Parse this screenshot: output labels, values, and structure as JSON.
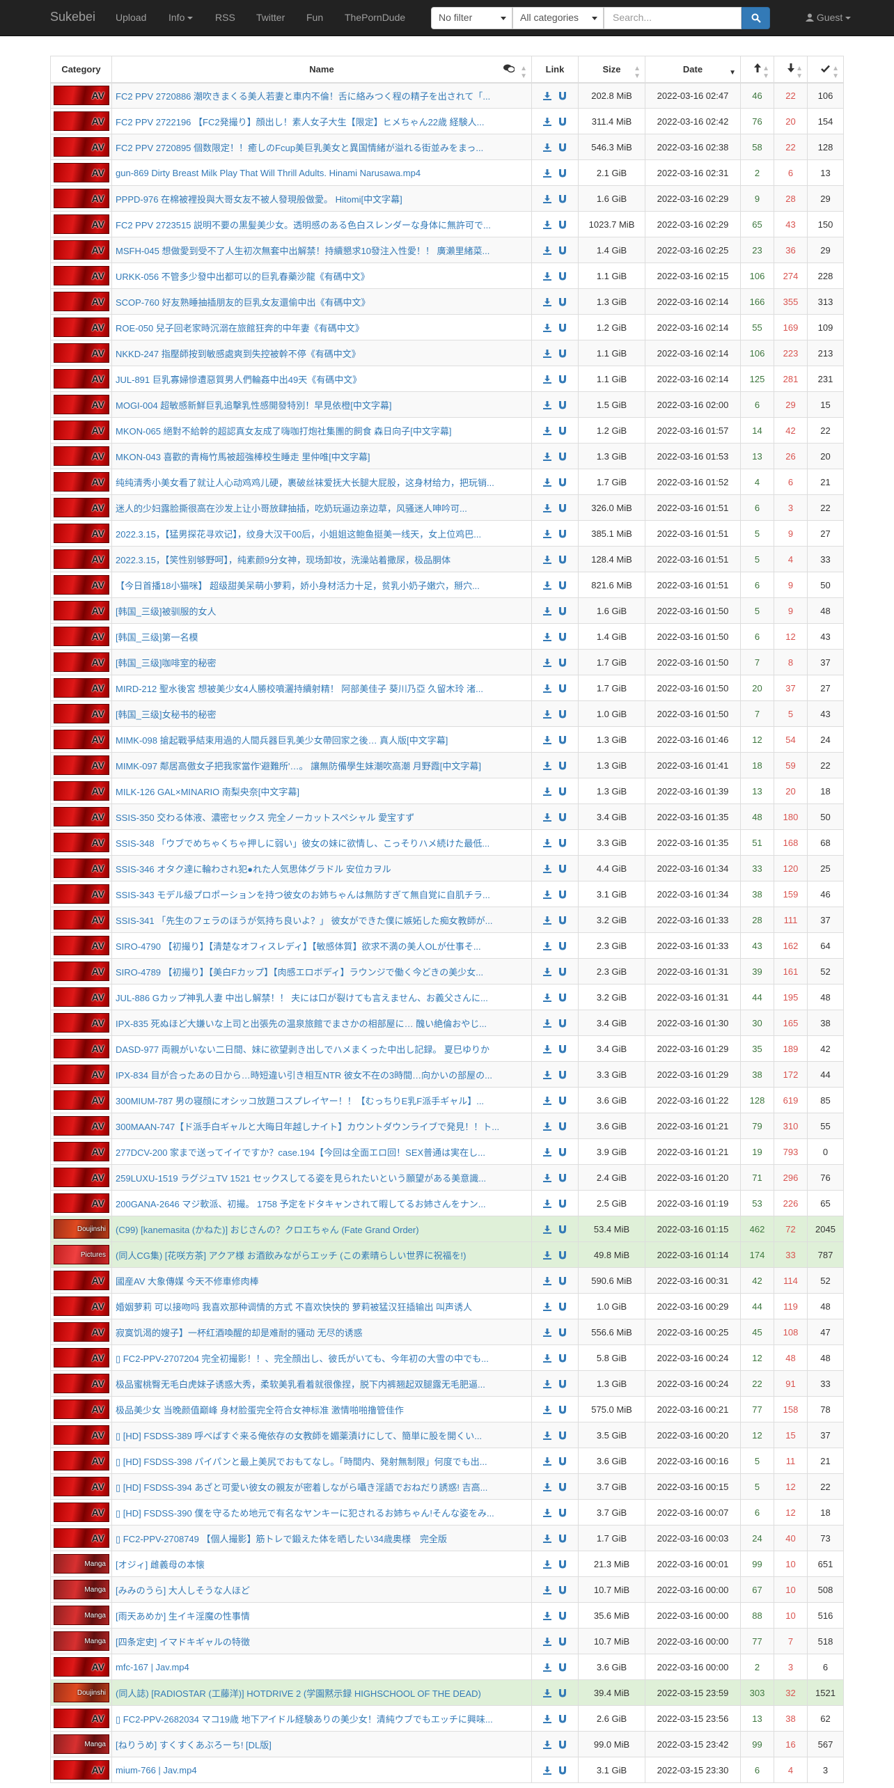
{
  "nav": {
    "brand": "Sukebei",
    "upload": "Upload",
    "info": "Info",
    "rss": "RSS",
    "twitter": "Twitter",
    "fun": "Fun",
    "theporndude": "ThePornDude",
    "filter": "No filter",
    "category": "All categories",
    "search_placeholder": "Search...",
    "guest": "Guest"
  },
  "columns": {
    "category": "Category",
    "name": "Name",
    "link": "Link",
    "size": "Size",
    "date": "Date"
  },
  "rows": [
    {
      "cat": "AV",
      "name": "FC2 PPV 2720886 潮吹きまくる美人若妻と車内不倫！舌に絡みつく程の精子を出されて「...",
      "size": "202.8 MiB",
      "date": "2022-03-16 02:47",
      "seed": "46",
      "leech": "22",
      "dl": "106"
    },
    {
      "cat": "AV",
      "name": "FC2 PPV 2722196 【FC2発撮り】顔出し！素人女子大生【限定】ヒメちゃん22歳 経験人...",
      "size": "311.4 MiB",
      "date": "2022-03-16 02:42",
      "seed": "76",
      "leech": "20",
      "dl": "154"
    },
    {
      "cat": "AV",
      "name": "FC2 PPV 2720895 個数限定！！癒しのFcup美巨乳美女と異国情緒が溢れる街並みをまっ...",
      "size": "546.3 MiB",
      "date": "2022-03-16 02:38",
      "seed": "58",
      "leech": "22",
      "dl": "128"
    },
    {
      "cat": "AV",
      "name": "gun-869 Dirty Breast Milk Play That Will Thrill Adults. Hinami Narusawa.mp4",
      "size": "2.1 GiB",
      "date": "2022-03-16 02:31",
      "seed": "2",
      "leech": "6",
      "dl": "13"
    },
    {
      "cat": "AV",
      "name": "PPPD-976 在棉被裡投與大哥女友不被人發現般做愛。 Hitomi[中文字幕]",
      "size": "1.6 GiB",
      "date": "2022-03-16 02:29",
      "seed": "9",
      "leech": "28",
      "dl": "29"
    },
    {
      "cat": "AV",
      "name": "FC2 PPV 2723515 説明不要の黒髪美少女。透明感のある色白スレンダーな身体に無許可で...",
      "size": "1023.7 MiB",
      "date": "2022-03-16 02:29",
      "seed": "65",
      "leech": "43",
      "dl": "150"
    },
    {
      "cat": "AV",
      "name": "MSFH-045 想做愛到受不了人生初次無套中出解禁！持續懇求10發注入性愛！！ 廣瀨里緒菜...",
      "size": "1.4 GiB",
      "date": "2022-03-16 02:25",
      "seed": "23",
      "leech": "36",
      "dl": "29"
    },
    {
      "cat": "AV",
      "name": "URKK-056 不管多少發中出都可以的巨乳春藥沙龍《有碼中文》",
      "size": "1.1 GiB",
      "date": "2022-03-16 02:15",
      "seed": "106",
      "leech": "274",
      "dl": "228"
    },
    {
      "cat": "AV",
      "name": "SCOP-760 好友熟睡抽插朋友的巨乳女友還偷中出《有碼中文》",
      "size": "1.3 GiB",
      "date": "2022-03-16 02:14",
      "seed": "166",
      "leech": "355",
      "dl": "313"
    },
    {
      "cat": "AV",
      "name": "ROE-050 兒子回老家時沉溺在旅館狂奔的中年妻《有碼中文》",
      "size": "1.2 GiB",
      "date": "2022-03-16 02:14",
      "seed": "55",
      "leech": "169",
      "dl": "109"
    },
    {
      "cat": "AV",
      "name": "NKKD-247 指壓師按到敏感處爽到失控被幹不停《有碼中文》",
      "size": "1.1 GiB",
      "date": "2022-03-16 02:14",
      "seed": "106",
      "leech": "223",
      "dl": "213"
    },
    {
      "cat": "AV",
      "name": "JUL-891 巨乳寡婦慘遭惡質男人們輪姦中出49天《有碼中文》",
      "size": "1.1 GiB",
      "date": "2022-03-16 02:14",
      "seed": "125",
      "leech": "281",
      "dl": "231"
    },
    {
      "cat": "AV",
      "name": "MOGI-004 超敏感新鮮巨乳追擊乳性感開發特別！早見依橙[中文字幕]",
      "size": "1.5 GiB",
      "date": "2022-03-16 02:00",
      "seed": "6",
      "leech": "29",
      "dl": "15"
    },
    {
      "cat": "AV",
      "name": "MKON-065 絕對不給幹的超認真女友成了嗨咖打炮社集團的飼食 森日向子[中文字幕]",
      "size": "1.2 GiB",
      "date": "2022-03-16 01:57",
      "seed": "14",
      "leech": "42",
      "dl": "22"
    },
    {
      "cat": "AV",
      "name": "MKON-043 喜歡的青梅竹馬被超強棒校生睡走 里仲唯[中文字幕]",
      "size": "1.3 GiB",
      "date": "2022-03-16 01:53",
      "seed": "13",
      "leech": "26",
      "dl": "20"
    },
    {
      "cat": "AV",
      "name": "纯纯清秀小美女看了就让人心动鸡鸡儿硬，裹破丝袜爱抚大长腿大屁股，这身材给力，把玩销...",
      "size": "1.7 GiB",
      "date": "2022-03-16 01:52",
      "seed": "4",
      "leech": "6",
      "dl": "21"
    },
    {
      "cat": "AV",
      "name": "迷人的少妇露脸撕很高在沙发上让小哥放肆抽插，吃奶玩逼边亲边草，风骚迷人呻吟可...",
      "size": "326.0 MiB",
      "date": "2022-03-16 01:51",
      "seed": "6",
      "leech": "3",
      "dl": "22"
    },
    {
      "cat": "AV",
      "name": "2022.3.15，【猛男探花寻欢记】，纹身大汉干00后，小姐姐这鲍鱼挺美一线天，女上位鸡巴...",
      "size": "385.1 MiB",
      "date": "2022-03-16 01:51",
      "seed": "5",
      "leech": "9",
      "dl": "27"
    },
    {
      "cat": "AV",
      "name": "2022.3.15，【笑性别够野呵】，纯素颜9分女神，现场卸妆，洗澡站着撒尿，极品胴体",
      "size": "128.4 MiB",
      "date": "2022-03-16 01:51",
      "seed": "5",
      "leech": "4",
      "dl": "33"
    },
    {
      "cat": "AV",
      "name": "【今日首播18小猫咪】 超级甜美呆萌小萝莉，娇小身材活力十足，贫乳小奶子嫩穴，掰穴...",
      "size": "821.6 MiB",
      "date": "2022-03-16 01:51",
      "seed": "6",
      "leech": "9",
      "dl": "50"
    },
    {
      "cat": "AV",
      "name": "[韩国_三级]被驯服的女人",
      "size": "1.6 GiB",
      "date": "2022-03-16 01:50",
      "seed": "5",
      "leech": "9",
      "dl": "48"
    },
    {
      "cat": "AV",
      "name": "[韩国_三级]第一名模",
      "size": "1.4 GiB",
      "date": "2022-03-16 01:50",
      "seed": "6",
      "leech": "12",
      "dl": "43"
    },
    {
      "cat": "AV",
      "name": "[韩国_三级]咖啡室的秘密",
      "size": "1.7 GiB",
      "date": "2022-03-16 01:50",
      "seed": "7",
      "leech": "8",
      "dl": "37"
    },
    {
      "cat": "AV",
      "name": "MIRD-212 聖水後宮 想被美少女4人勝校噴灑持續射精！ 阿部美佳子 葵川乃亞 久留木玲 渚...",
      "size": "1.7 GiB",
      "date": "2022-03-16 01:50",
      "seed": "20",
      "leech": "37",
      "dl": "27"
    },
    {
      "cat": "AV",
      "name": "[韩国_三级]女秘书的秘密",
      "size": "1.0 GiB",
      "date": "2022-03-16 01:50",
      "seed": "7",
      "leech": "5",
      "dl": "43"
    },
    {
      "cat": "AV",
      "name": "MIMK-098 搶起戰爭結束用過的人間兵器巨乳美少女帶回家之後… 真人版[中文字幕]",
      "size": "1.3 GiB",
      "date": "2022-03-16 01:46",
      "seed": "12",
      "leech": "54",
      "dl": "24"
    },
    {
      "cat": "AV",
      "name": "MIMK-097 鄰居高傲女子把我家當作'避難所'…。 讓無防備學生妹潮吹高潮 月野霞[中文字幕]",
      "size": "1.3 GiB",
      "date": "2022-03-16 01:41",
      "seed": "18",
      "leech": "59",
      "dl": "22"
    },
    {
      "cat": "AV",
      "name": "MILK-126 GAL×MINARIO 南梨央奈[中文字幕]",
      "size": "1.3 GiB",
      "date": "2022-03-16 01:39",
      "seed": "13",
      "leech": "20",
      "dl": "18"
    },
    {
      "cat": "AV",
      "name": "SSIS-350 交わる体液、濃密セックス 完全ノーカットスペシャル 愛宝すず",
      "size": "3.4 GiB",
      "date": "2022-03-16 01:35",
      "seed": "48",
      "leech": "180",
      "dl": "50"
    },
    {
      "cat": "AV",
      "name": "SSIS-348 「ウブでめちゃくちゃ押しに弱い」彼女の妹に欲情し、こっそりハメ続けた最低...",
      "size": "3.3 GiB",
      "date": "2022-03-16 01:35",
      "seed": "51",
      "leech": "168",
      "dl": "68"
    },
    {
      "cat": "AV",
      "name": "SSIS-346 オタク達に輪わされ犯●れた人気思体グラドル 安位カヲル",
      "size": "4.4 GiB",
      "date": "2022-03-16 01:34",
      "seed": "33",
      "leech": "120",
      "dl": "25"
    },
    {
      "cat": "AV",
      "name": "SSIS-343 モデル級プロポーションを持つ彼女のお姉ちゃんは無防すぎて無自覚に自肌チラ...",
      "size": "3.1 GiB",
      "date": "2022-03-16 01:34",
      "seed": "38",
      "leech": "159",
      "dl": "46"
    },
    {
      "cat": "AV",
      "name": "SSIS-341 「先生のフェラのほうが気持ち良いよ？」 彼女ができた僕に嫉妬した痴女教師が...",
      "size": "3.2 GiB",
      "date": "2022-03-16 01:33",
      "seed": "28",
      "leech": "111",
      "dl": "37"
    },
    {
      "cat": "AV",
      "name": "SIRO-4790 【初撮り】【清楚なオフィスレディ】【敏感体質】欲求不満の美人OLが仕事そ...",
      "size": "2.3 GiB",
      "date": "2022-03-16 01:33",
      "seed": "43",
      "leech": "162",
      "dl": "64"
    },
    {
      "cat": "AV",
      "name": "SIRO-4789 【初撮り】【美白Fカップ】【肉感エロボディ】ラウンジで働く今どきの美少女...",
      "size": "2.3 GiB",
      "date": "2022-03-16 01:31",
      "seed": "39",
      "leech": "161",
      "dl": "52"
    },
    {
      "cat": "AV",
      "name": "JUL-886 Gカップ神乳人妻 中出し解禁！！ 夫には口が裂けても言えません、お義父さんに...",
      "size": "3.2 GiB",
      "date": "2022-03-16 01:31",
      "seed": "44",
      "leech": "195",
      "dl": "48"
    },
    {
      "cat": "AV",
      "name": "IPX-835 死ぬほど大嫌いな上司と出張先の温泉旅館でまさかの相部屋に… 醜い絶倫おやじ...",
      "size": "3.4 GiB",
      "date": "2022-03-16 01:30",
      "seed": "30",
      "leech": "165",
      "dl": "38"
    },
    {
      "cat": "AV",
      "name": "DASD-977 両親がいない二日間、妹に欲望剥き出しでハメまくった中出し記録。 夏巳ゆりか",
      "size": "3.4 GiB",
      "date": "2022-03-16 01:29",
      "seed": "35",
      "leech": "189",
      "dl": "42"
    },
    {
      "cat": "AV",
      "name": "IPX-834 目が合ったあの日から…時短違い引き相互NTR 彼女不在の3時間…向かいの部屋の...",
      "size": "3.3 GiB",
      "date": "2022-03-16 01:29",
      "seed": "38",
      "leech": "172",
      "dl": "44"
    },
    {
      "cat": "AV",
      "name": "300MIUM-787 男の寝顔にオシッコ放題コスプレイヤー！！【むっちりE乳F派手ギャル】...",
      "size": "3.6 GiB",
      "date": "2022-03-16 01:22",
      "seed": "128",
      "leech": "619",
      "dl": "85"
    },
    {
      "cat": "AV",
      "name": "300MAAN-747【ド派手白ギャルと大晦日年越しナイト】カウントダウンライブで発見！！ト...",
      "size": "3.6 GiB",
      "date": "2022-03-16 01:21",
      "seed": "79",
      "leech": "310",
      "dl": "55"
    },
    {
      "cat": "AV",
      "name": "277DCV-200 家まで送ってイイですか？case.194【今回は全面エロ回！SEX普通は実在し...",
      "size": "3.9 GiB",
      "date": "2022-03-16 01:21",
      "seed": "19",
      "leech": "793",
      "dl": "0"
    },
    {
      "cat": "AV",
      "name": "259LUXU-1519 ラグジュTV 1521 セックスしてる姿を見られたいという願望がある美意識...",
      "size": "2.4 GiB",
      "date": "2022-03-16 01:20",
      "seed": "71",
      "leech": "296",
      "dl": "76"
    },
    {
      "cat": "AV",
      "name": "200GANA-2646 マジ軟派、初撮。 1758 予定をドタキャンされて暇してるお姉さんをナン...",
      "size": "2.5 GiB",
      "date": "2022-03-16 01:19",
      "seed": "53",
      "leech": "226",
      "dl": "65"
    },
    {
      "cat": "Doujinshi",
      "name": "(C99) [kanemasita (かねた)] おじさんの？クロエちゃん (Fate Grand Order)",
      "size": "53.4 MiB",
      "date": "2022-03-16 01:15",
      "seed": "462",
      "leech": "72",
      "dl": "2045",
      "trusted": true
    },
    {
      "cat": "Pictures",
      "name": "(同人CG集) [花咲方茶] アクア様 お酒飲みながらエッチ (この素晴らしい世界に祝福を!)",
      "size": "49.8 MiB",
      "date": "2022-03-16 01:14",
      "seed": "174",
      "leech": "33",
      "dl": "787",
      "trusted": true
    },
    {
      "cat": "AV",
      "name": "國産AV 大象傳媒 今天不修車修肉棒",
      "size": "590.6 MiB",
      "date": "2022-03-16 00:31",
      "seed": "42",
      "leech": "114",
      "dl": "52"
    },
    {
      "cat": "AV",
      "name": "婚姻萝莉 可以接吻吗 我喜欢那种调情的方式 不喜欢快快的 萝莉被猛汉狂插输出 叫声诱人",
      "size": "1.0 GiB",
      "date": "2022-03-16 00:29",
      "seed": "44",
      "leech": "119",
      "dl": "48"
    },
    {
      "cat": "AV",
      "name": "寂寞饥渴的嫂子】一杯红酒喚醒的却是难耐的骚动 无尽的诱惑",
      "size": "556.6 MiB",
      "date": "2022-03-16 00:25",
      "seed": "45",
      "leech": "108",
      "dl": "47"
    },
    {
      "cat": "AV",
      "name": "▯ FC2-PPV-2707204 完全初撮影！！、完全顔出し、彼氏がいても、今年初の大雪の中でも...",
      "size": "5.8 GiB",
      "date": "2022-03-16 00:24",
      "seed": "12",
      "leech": "48",
      "dl": "48"
    },
    {
      "cat": "AV",
      "name": "极品蜜桃臀无毛白虎妹子诱惑大秀，柔软美乳看着就很像捏，脱下内裤翘起双腿露无毛肥逼...",
      "size": "1.3 GiB",
      "date": "2022-03-16 00:24",
      "seed": "22",
      "leech": "91",
      "dl": "33"
    },
    {
      "cat": "AV",
      "name": "极品美少女 当晚颜值巅峰 身材脸蛋完全符合女神标准 激情啪啪撸管佳作",
      "size": "575.0 MiB",
      "date": "2022-03-16 00:21",
      "seed": "77",
      "leech": "158",
      "dl": "78"
    },
    {
      "cat": "AV",
      "name": "▯ [HD] FSDSS-389 呼べばすぐ来る俺依存の女教師を媚薬漬けにして、簡単に股を開くい...",
      "size": "3.5 GiB",
      "date": "2022-03-16 00:20",
      "seed": "12",
      "leech": "15",
      "dl": "37"
    },
    {
      "cat": "AV",
      "name": "▯ [HD] FSDSS-398 パイパンと最上美尻でおもてなし。「時間内、発射無制限」何度でも出...",
      "size": "3.6 GiB",
      "date": "2022-03-16 00:16",
      "seed": "5",
      "leech": "11",
      "dl": "21"
    },
    {
      "cat": "AV",
      "name": "▯ [HD] FSDSS-394 あざと可愛い彼女の親友が密着しながら囁き淫語でおねだり誘惑! 吉高...",
      "size": "3.7 GiB",
      "date": "2022-03-16 00:15",
      "seed": "5",
      "leech": "12",
      "dl": "22"
    },
    {
      "cat": "AV",
      "name": "▯ [HD] FSDSS-390 僕を守るため地元で有名なヤンキーに犯されるお姉ちゃん!そんな姿をみ...",
      "size": "3.7 GiB",
      "date": "2022-03-16 00:07",
      "seed": "6",
      "leech": "12",
      "dl": "18"
    },
    {
      "cat": "AV",
      "name": "▯ FC2-PPV-2708749 【個人撮影】筋トレで鍛えた体を晒したい34歳奥様　完全版",
      "size": "1.7 GiB",
      "date": "2022-03-16 00:03",
      "seed": "24",
      "leech": "40",
      "dl": "73"
    },
    {
      "cat": "Manga",
      "name": "[オジィ] 雌義母の本懐",
      "size": "21.3 MiB",
      "date": "2022-03-16 00:01",
      "seed": "99",
      "leech": "10",
      "dl": "651"
    },
    {
      "cat": "Manga",
      "name": "[みみのうら] 大人しそうな人ほど",
      "size": "10.7 MiB",
      "date": "2022-03-16 00:00",
      "seed": "67",
      "leech": "10",
      "dl": "508"
    },
    {
      "cat": "Manga",
      "name": "[雨天あめか] 生イキ淫魔の性事情",
      "size": "35.6 MiB",
      "date": "2022-03-16 00:00",
      "seed": "88",
      "leech": "10",
      "dl": "516"
    },
    {
      "cat": "Manga",
      "name": "[四条定史] イマドキギャルの特徴",
      "size": "10.7 MiB",
      "date": "2022-03-16 00:00",
      "seed": "77",
      "leech": "7",
      "dl": "518"
    },
    {
      "cat": "AV",
      "name": "mfc-167 | Jav.mp4",
      "size": "3.6 GiB",
      "date": "2022-03-16 00:00",
      "seed": "2",
      "leech": "3",
      "dl": "6"
    },
    {
      "cat": "Doujinshi",
      "name": "(同人誌) [RADIOSTAR (工藤洋)] HOTDRIVE 2 (学園黙示録 HIGHSCHOOL OF THE DEAD)",
      "size": "39.4 MiB",
      "date": "2022-03-15 23:59",
      "seed": "303",
      "leech": "32",
      "dl": "1521",
      "trusted": true
    },
    {
      "cat": "AV",
      "name": "▯ FC2-PPV-2682034 マコ19歳 地下アイドル経験ありの美少女！清純ウブでもエッチに興味...",
      "size": "2.6 GiB",
      "date": "2022-03-15 23:56",
      "seed": "13",
      "leech": "38",
      "dl": "62"
    },
    {
      "cat": "Manga",
      "name": "[ねりうめ] すくすくあぶろーち! [DL版]",
      "size": "99.0 MiB",
      "date": "2022-03-15 23:42",
      "seed": "99",
      "leech": "16",
      "dl": "567"
    },
    {
      "cat": "AV",
      "name": "mium-766 | Jav.mp4",
      "size": "3.1 GiB",
      "date": "2022-03-15 23:30",
      "seed": "6",
      "leech": "4",
      "dl": "3"
    }
  ]
}
